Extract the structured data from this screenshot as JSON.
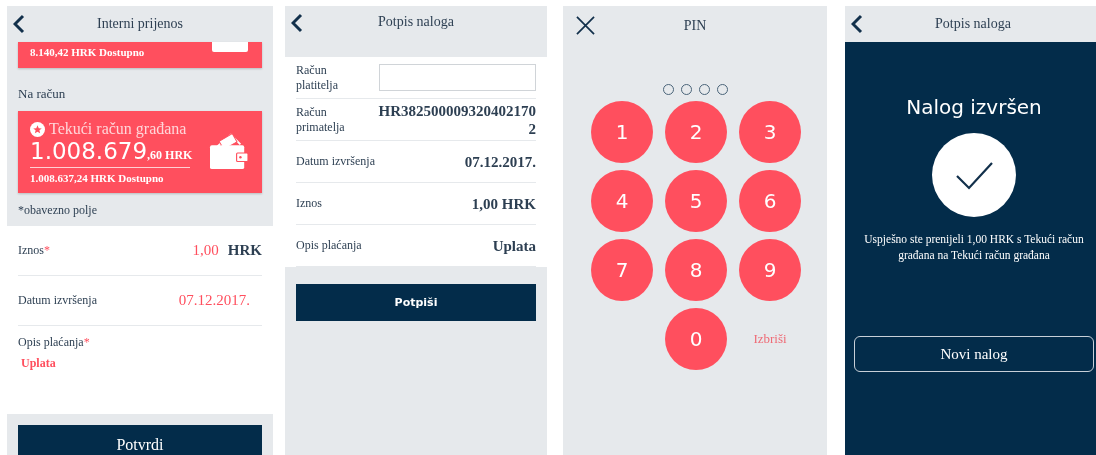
{
  "transfer_screen": {
    "title": "Interni prijenos",
    "from_card": {
      "available": "8.140,42 HRK Dostupno"
    },
    "to_label": "Na račun",
    "to_card": {
      "name": "Tekući račun građana",
      "amount_main": "1.008.679",
      "amount_fraction": ",60 HRK",
      "available": "1.008.637,24 HRK Dostupno"
    },
    "required_note": "*obavezno polje",
    "fields": [
      {
        "kind": "amount",
        "label": "Iznos",
        "mark": "*",
        "value": "1,00",
        "unit": "HRK"
      },
      {
        "kind": "inline",
        "label": "Datum izvršenja",
        "value": "07.12.2017."
      },
      {
        "kind": "stacked",
        "label": "Opis plaćanja",
        "mark": "*",
        "value": "Uplata"
      }
    ],
    "button": "Potvrdi"
  },
  "sign_screen": {
    "title": "Potpis naloga",
    "rows": [
      {
        "kind": "input",
        "label": "Račun platitelja"
      },
      {
        "kind": "text",
        "label": "Račun primatelja",
        "value": "HR3825000093204021702"
      },
      {
        "kind": "text",
        "label": "Datum izvršenja",
        "value": "07.12.2017."
      },
      {
        "kind": "text",
        "label": "Iznos",
        "value": "1,00 HRK"
      },
      {
        "kind": "text",
        "label": "Opis plaćanja",
        "value": "Uplata"
      }
    ],
    "button": "Potpiši"
  },
  "pin_screen": {
    "title": "PIN",
    "dots": [
      {
        "filled": false
      },
      {
        "filled": false
      },
      {
        "filled": false
      },
      {
        "filled": false
      }
    ],
    "keys": [
      "1",
      "2",
      "3",
      "4",
      "5",
      "6",
      "7",
      "8",
      "9",
      "0"
    ],
    "delete": "Izbriši"
  },
  "success_screen": {
    "title": "Potpis naloga",
    "heading": "Nalog izvršen",
    "message": "Uspješno ste prenijeli 1,00 HRK s Tekući račun građana na Tekući račun građana",
    "button": "Novi nalog"
  }
}
